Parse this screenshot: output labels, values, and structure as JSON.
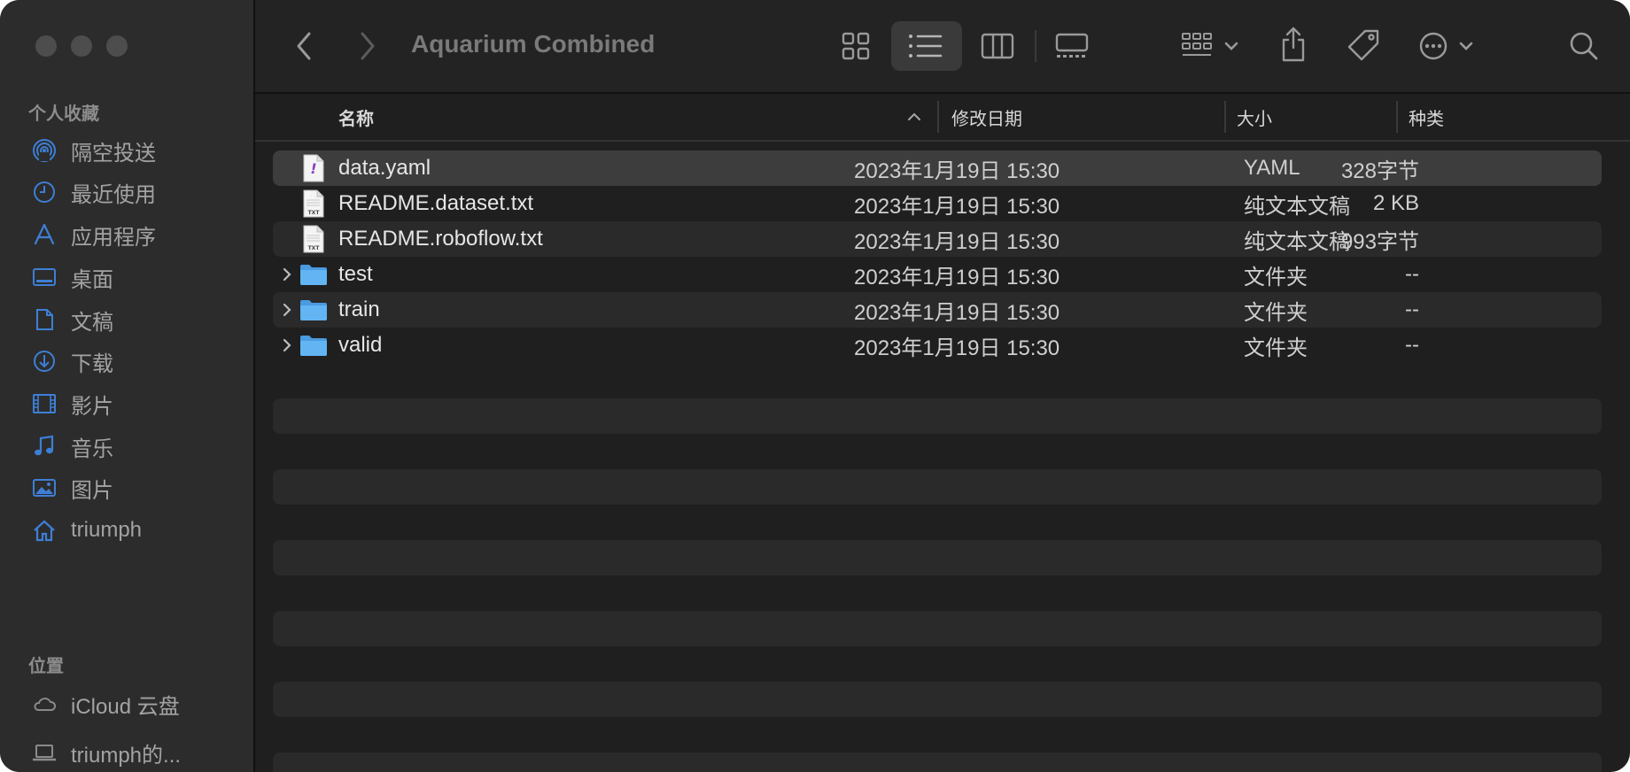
{
  "toolbar": {
    "title": "Aquarium Combined"
  },
  "sidebar": {
    "favorites_header": "个人收藏",
    "locations_header": "位置",
    "favorites": [
      {
        "label": "隔空投送",
        "icon": "airdrop-icon"
      },
      {
        "label": "最近使用",
        "icon": "clock-icon"
      },
      {
        "label": "应用程序",
        "icon": "applications-icon"
      },
      {
        "label": "桌面",
        "icon": "desktop-icon"
      },
      {
        "label": "文稿",
        "icon": "document-icon"
      },
      {
        "label": "下载",
        "icon": "download-icon"
      },
      {
        "label": "影片",
        "icon": "film-icon"
      },
      {
        "label": "音乐",
        "icon": "music-icon"
      },
      {
        "label": "图片",
        "icon": "photo-icon"
      },
      {
        "label": "triumph",
        "icon": "home-icon"
      }
    ],
    "locations": [
      {
        "label": "iCloud 云盘",
        "icon": "cloud-icon"
      },
      {
        "label": "triumph的...",
        "icon": "laptop-icon"
      }
    ]
  },
  "columns": {
    "name": "名称",
    "date": "修改日期",
    "size": "大小",
    "kind": "种类"
  },
  "files": [
    {
      "name": "data.yaml",
      "date": "2023年1月19日 15:30",
      "size": "328字节",
      "kind": "YAML",
      "type": "yaml"
    },
    {
      "name": "README.dataset.txt",
      "date": "2023年1月19日 15:30",
      "size": "2 KB",
      "kind": "纯文本文稿",
      "type": "txt"
    },
    {
      "name": "README.roboflow.txt",
      "date": "2023年1月19日 15:30",
      "size": "993字节",
      "kind": "纯文本文稿",
      "type": "txt"
    },
    {
      "name": "test",
      "date": "2023年1月19日 15:30",
      "size": "--",
      "kind": "文件夹",
      "type": "folder"
    },
    {
      "name": "train",
      "date": "2023年1月19日 15:30",
      "size": "--",
      "kind": "文件夹",
      "type": "folder"
    },
    {
      "name": "valid",
      "date": "2023年1月19日 15:30",
      "size": "--",
      "kind": "文件夹",
      "type": "folder"
    }
  ],
  "colors": {
    "sidebar_icon": "#3d7fd6",
    "folder": "#5aaef0",
    "selected_row": "#3d3d3d"
  }
}
